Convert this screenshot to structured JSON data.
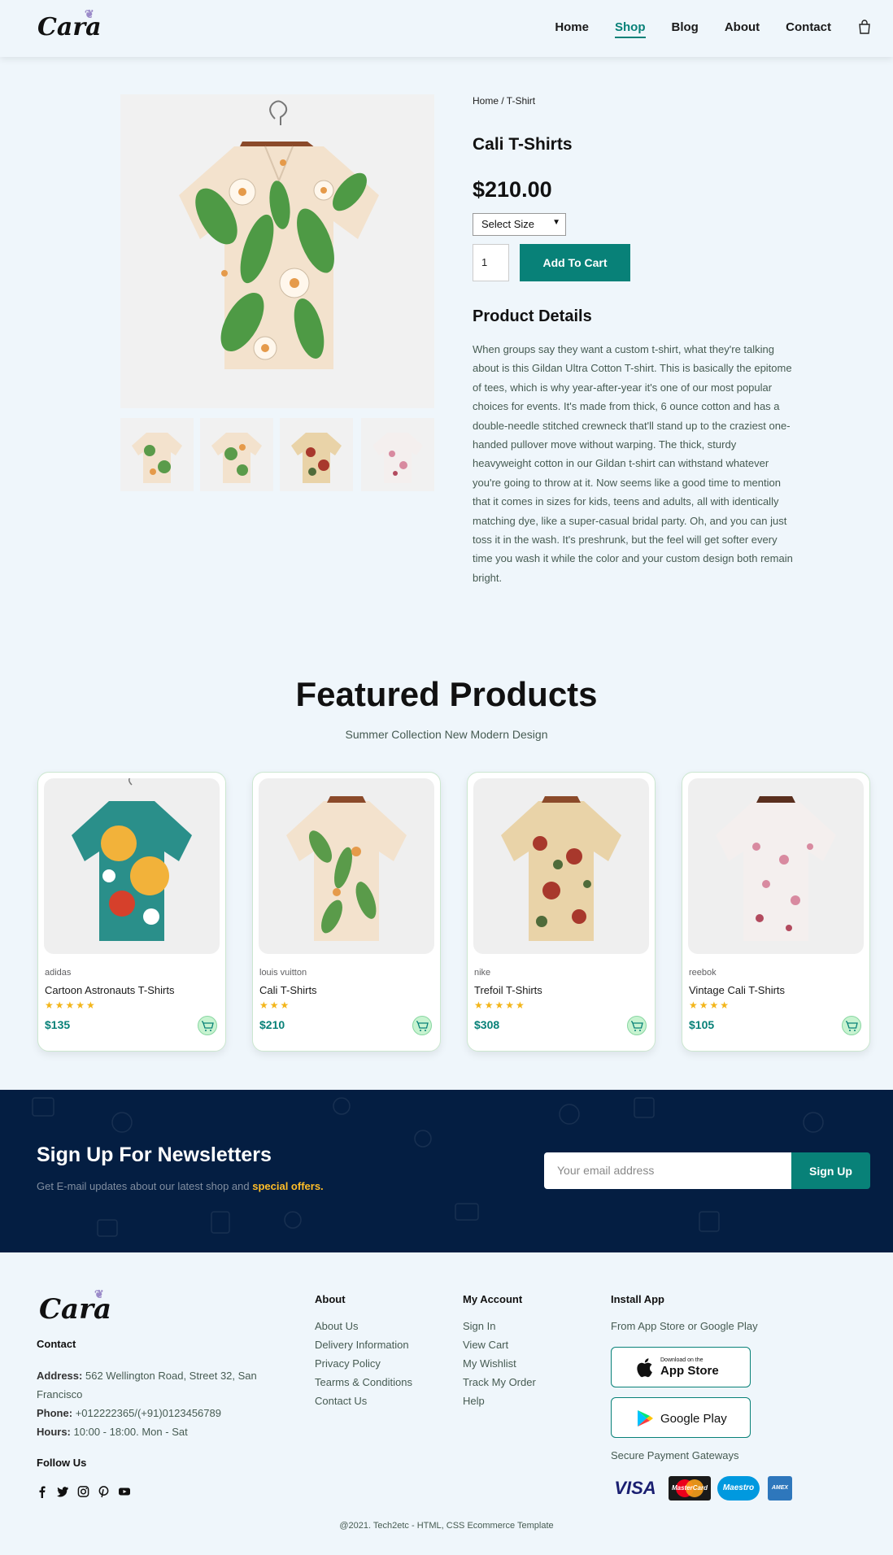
{
  "header": {
    "logo": "Cara",
    "nav": [
      "Home",
      "Shop",
      "Blog",
      "About",
      "Contact"
    ],
    "active": "Shop"
  },
  "product": {
    "breadcrumb": "Home / T-Shirt",
    "title": "Cali T-Shirts",
    "price": "$210.00",
    "size_select": "Select Size",
    "quantity": "1",
    "add_to_cart": "Add To Cart",
    "details_heading": "Product Details",
    "details_text": "When groups say they want a custom t-shirt, what they're talking about is this Gildan Ultra Cotton T-shirt. This is basically the epitome of tees, which is why year-after-year it's one of our most popular choices for events. It's made from thick, 6 ounce cotton and has a double-needle stitched crewneck that'll stand up to the craziest one-handed pullover move without warping. The thick, sturdy heavyweight cotton in our Gildan t-shirt can withstand whatever you're going to throw at it. Now seems like a good time to mention that it comes in sizes for kids, teens and adults, all with identically matching dye, like a super-casual bridal party. Oh, and you can just toss it in the wash. It's preshrunk, but the feel will get softer every time you wash it while the color and your custom design both remain bright."
  },
  "featured": {
    "title": "Featured Products",
    "subtitle": "Summer Collection New Modern Design",
    "products": [
      {
        "brand": "adidas",
        "name": "Cartoon Astronauts T-Shirts",
        "stars": 5,
        "price": "$135",
        "colors": [
          "#2a8f8a",
          "#f2b23a",
          "#d6402b"
        ]
      },
      {
        "brand": "louis vuitton",
        "name": "Cali T-Shirts",
        "stars": 3,
        "price": "$210",
        "colors": [
          "#f3e2cd",
          "#5a9b4a",
          "#e59a4a"
        ]
      },
      {
        "brand": "nike",
        "name": "Trefoil T-Shirts",
        "stars": 5,
        "price": "$308",
        "colors": [
          "#e9d3a8",
          "#a8382c",
          "#4f6b3a"
        ]
      },
      {
        "brand": "reebok",
        "name": "Vintage Cali T-Shirts",
        "stars": 4,
        "price": "$105",
        "colors": [
          "#f4efee",
          "#d88aa0",
          "#b24a5e"
        ]
      }
    ]
  },
  "newsletter": {
    "heading": "Sign Up For Newsletters",
    "text": "Get E-mail updates about our latest shop and",
    "highlight": "special offers.",
    "placeholder": "Your email address",
    "button": "Sign Up"
  },
  "footer": {
    "logo": "Cara",
    "contact_heading": "Contact",
    "address_label": "Address:",
    "address": "562 Wellington Road, Street 32, San Francisco",
    "phone_label": "Phone:",
    "phone": "+012222365/(+91)0123456789",
    "hours_label": "Hours:",
    "hours": "10:00 - 18:00. Mon - Sat",
    "follow": "Follow Us",
    "about_heading": "About",
    "about_links": [
      "About Us",
      "Delivery Information",
      "Privacy Policy",
      "Tearms & Conditions",
      "Contact Us"
    ],
    "account_heading": "My Account",
    "account_links": [
      "Sign In",
      "View Cart",
      "My Wishlist",
      "Track My Order",
      "Help"
    ],
    "app_heading": "Install App",
    "app_sub": "From App Store or Google Play",
    "appstore_small": "Download on the",
    "appstore_big": "App Store",
    "googleplay": "Google Play",
    "payment_heading": "Secure Payment Gateways",
    "payments": [
      "VISA",
      "MasterCard",
      "Maestro",
      "AMEX"
    ],
    "copyright": "@2021. Tech2etc - HTML, CSS Ecommerce Template"
  },
  "colors": {
    "accent": "#088178",
    "navy": "#041e42",
    "star": "#f3b519",
    "highlight": "#ffbd27"
  }
}
